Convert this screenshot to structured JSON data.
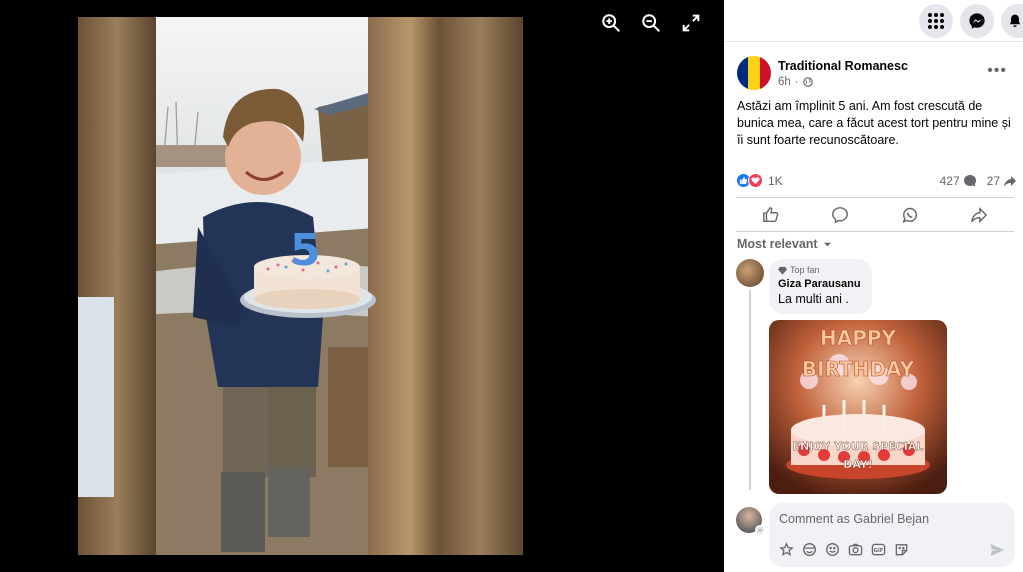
{
  "viewer": {
    "tools": [
      "zoom-in-icon",
      "zoom-out-icon",
      "fullscreen-icon"
    ]
  },
  "topbar": {
    "icons": [
      "menu-grid-icon",
      "messenger-icon",
      "notifications-bell-icon"
    ]
  },
  "post": {
    "page_name": "Traditional Romanesc",
    "time": "6h",
    "privacy_icon": "globe-icon",
    "text": "Astăzi am împlinit 5 ani. Am fost crescută de bunica mea, care a făcut acest tort pentru mine și îi sunt foarte recunoscătoare.",
    "flag_colors": [
      "#002B7F",
      "#FCD116",
      "#CE1126"
    ],
    "reactions_count": "1K",
    "comments_count": "427",
    "shares_count": "27"
  },
  "actions": [
    "like-icon",
    "comment-icon",
    "whatsapp-icon",
    "share-icon"
  ],
  "comments_filter": "Most relevant",
  "comment": {
    "badge": "Top fan",
    "author": "Giza Parausanu",
    "text": "La multi ani ."
  },
  "gif": {
    "line1": "HAPPY",
    "line2": "BIRTHDAY",
    "line3": "ENJOY YOUR SPECIAL",
    "line4": "DAY!"
  },
  "composer": {
    "placeholder": "Comment as Gabriel Bejan",
    "tools": [
      "avatar-sticker-icon",
      "emoji-icon",
      "smiley-icon",
      "camera-icon",
      "gif-icon",
      "sticker-icon"
    ]
  },
  "colors": {
    "accent": "#1877f2",
    "love": "#f33e58"
  }
}
